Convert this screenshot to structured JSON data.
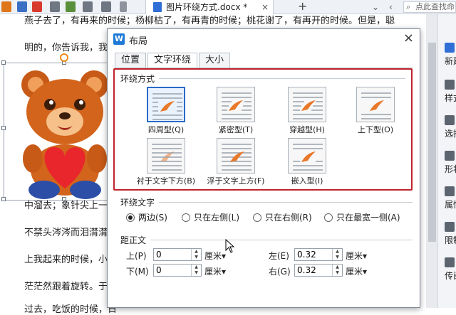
{
  "app": {
    "doc_tab_title": "图片环绕方式.docx *",
    "search_text": "点此查找命",
    "new_tab_label": "+",
    "tab_close": "×"
  },
  "document": {
    "lines": [
      "燕子去了，有再来的时候；杨柳枯了，有再青的时候；桃花谢了，有再开的时候。但是，聪",
      "明的，你告诉我，我们",
      "中溜去；象针尖上一滴",
      "不禁头涔涔而泪潸潸了",
      "上我起来的时候，小屋",
      "茫茫然跟着旋转。于是",
      "过去，吃饭的时候，日"
    ]
  },
  "sidebar": {
    "items": [
      {
        "label": "新建",
        "icon": "new-doc-icon"
      },
      {
        "label": "样式",
        "icon": "style-icon"
      },
      {
        "label": "选择",
        "icon": "select-icon"
      },
      {
        "label": "形状",
        "icon": "shape-icon"
      },
      {
        "label": "属性",
        "icon": "property-icon"
      },
      {
        "label": "限制",
        "icon": "restrict-icon"
      },
      {
        "label": "传阅",
        "icon": "share-icon"
      }
    ]
  },
  "dialog": {
    "title": "布局",
    "logo_letter": "W",
    "close_label": "×",
    "tabs": [
      {
        "label": "位置",
        "active": false
      },
      {
        "label": "文字环绕",
        "active": true
      },
      {
        "label": "大小",
        "active": false
      }
    ],
    "wrap_section_title": "环绕方式",
    "wrap_options": [
      {
        "label": "四周型(Q)",
        "selected": true
      },
      {
        "label": "紧密型(T)",
        "selected": false
      },
      {
        "label": "穿越型(H)",
        "selected": false
      },
      {
        "label": "上下型(O)",
        "selected": false
      },
      {
        "label": "衬于文字下方(B)",
        "selected": false
      },
      {
        "label": "浮于文字上方(F)",
        "selected": false
      },
      {
        "label": "嵌入型(I)",
        "selected": false
      }
    ],
    "wrap_text_section_title": "环绕文字",
    "wrap_text_options": [
      {
        "label": "两边(S)",
        "checked": true
      },
      {
        "label": "只在左侧(L)",
        "checked": false
      },
      {
        "label": "只在右侧(R)",
        "checked": false
      },
      {
        "label": "只在最宽一侧(A)",
        "checked": false
      }
    ],
    "distance_section_title": "距正文",
    "distance": {
      "top_label": "上(P)",
      "top_value": "0",
      "top_unit": "厘米▾",
      "bottom_label": "下(M)",
      "bottom_value": "0",
      "bottom_unit": "厘米▾",
      "left_label": "左(E)",
      "left_value": "0.32",
      "left_unit": "厘米▾",
      "right_label": "右(G)",
      "right_value": "0.32",
      "right_unit": "厘米▾"
    }
  },
  "colors": {
    "accent_blue": "#2b6ac9",
    "highlight_red": "#c0232d",
    "bear_brown": "#d3641b",
    "heart_red": "#e8262c"
  }
}
